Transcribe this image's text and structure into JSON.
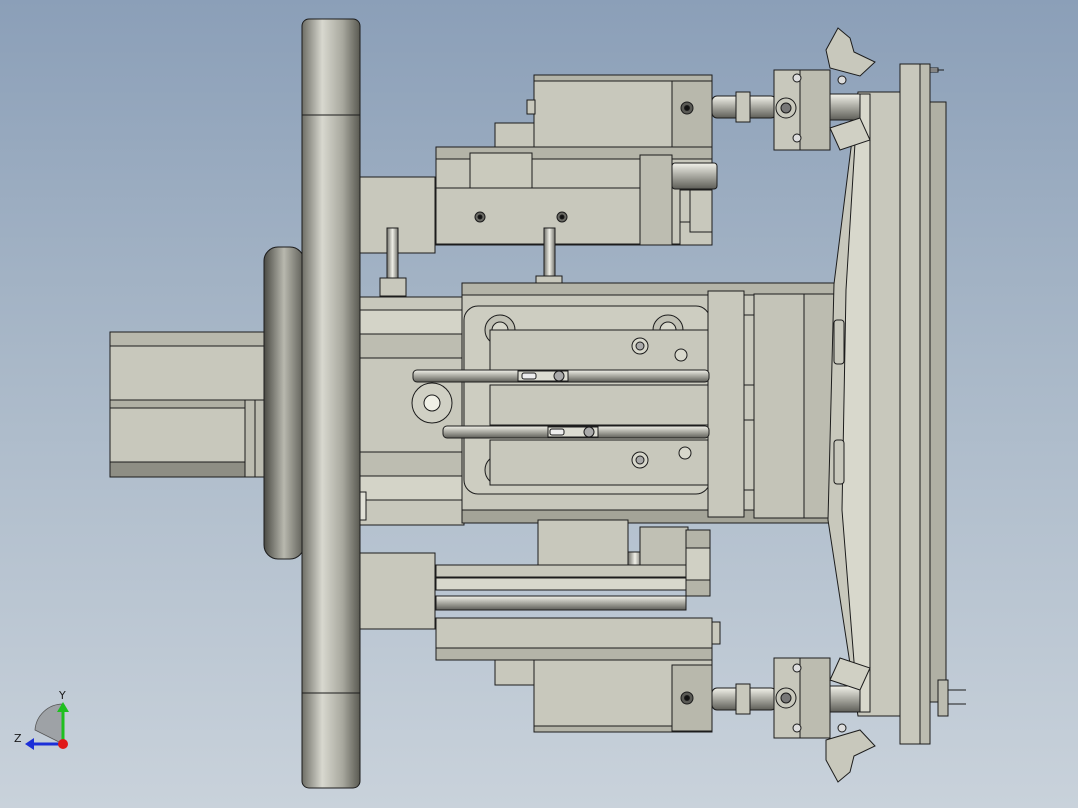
{
  "viewport": {
    "background_top": "#8b9fb8",
    "background_bottom": "#c9d2db",
    "part_color": "#c8c8bc",
    "edge_color": "#1c1c1c"
  },
  "triad": {
    "y_label": "Y",
    "z_label": "Z",
    "y_color": "#1fbf1f",
    "z_color": "#1c2fd8",
    "x_color": "#e01818"
  }
}
